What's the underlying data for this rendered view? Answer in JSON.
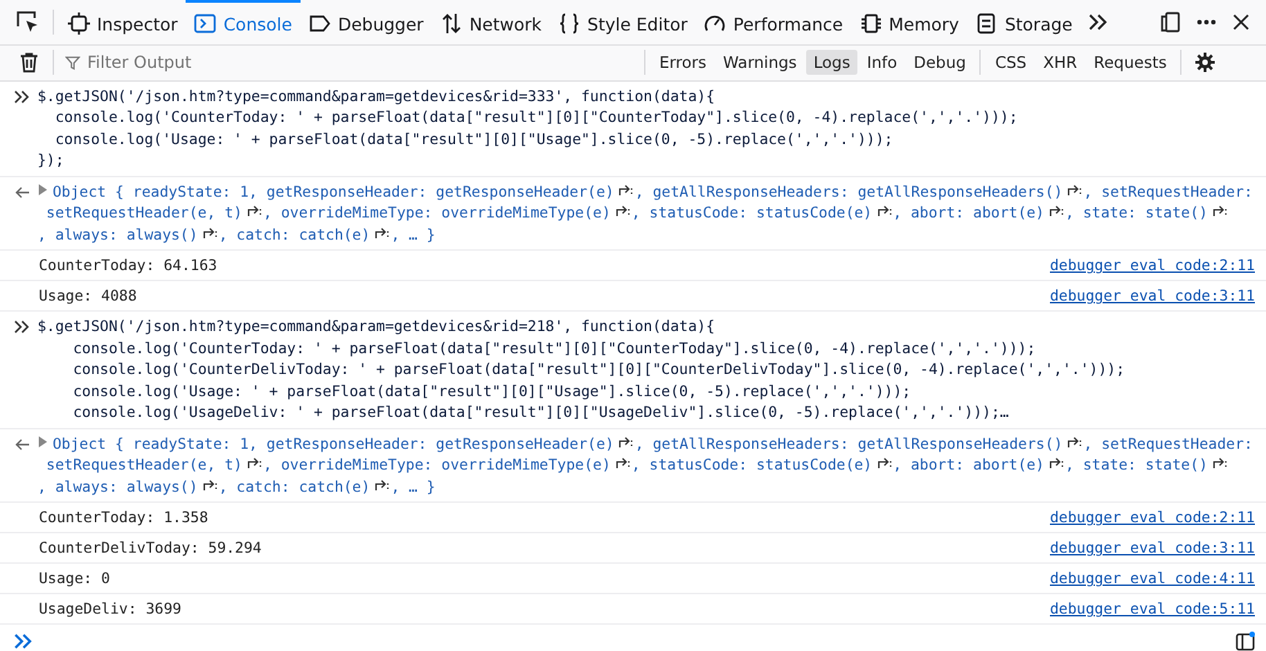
{
  "toolbar": {
    "tabs": [
      {
        "label": "Inspector",
        "selected": false
      },
      {
        "label": "Console",
        "selected": true
      },
      {
        "label": "Debugger",
        "selected": false
      },
      {
        "label": "Network",
        "selected": false
      },
      {
        "label": "Style Editor",
        "selected": false
      },
      {
        "label": "Performance",
        "selected": false
      },
      {
        "label": "Memory",
        "selected": false
      },
      {
        "label": "Storage",
        "selected": false
      }
    ]
  },
  "filter_bar": {
    "placeholder": "Filter Output",
    "filters": [
      {
        "label": "Errors",
        "selected": false
      },
      {
        "label": "Warnings",
        "selected": false
      },
      {
        "label": "Logs",
        "selected": true
      },
      {
        "label": "Info",
        "selected": false
      },
      {
        "label": "Debug",
        "selected": false
      },
      {
        "label": "CSS",
        "selected": false
      },
      {
        "label": "XHR",
        "selected": false
      },
      {
        "label": "Requests",
        "selected": false
      }
    ]
  },
  "messages": [
    {
      "kind": "input",
      "lines": [
        "$.getJSON('/json.htm?type=command&param=getdevices&rid=333', function(data){",
        "  console.log('CounterToday: ' + parseFloat(data[\"result\"][0][\"CounterToday\"].slice(0, -4).replace(',','.')));",
        "  console.log('Usage: ' + parseFloat(data[\"result\"][0][\"Usage\"].slice(0, -5).replace(',','.')));",
        "});"
      ]
    },
    {
      "kind": "result",
      "parts": [
        {
          "text": "Object { readyState: 1, getResponseHeader:",
          "kind": "key"
        },
        {
          "text": "getResponseHeader(e)",
          "kind": "function"
        },
        {
          "text": ", getAllResponseHeaders:",
          "kind": "key"
        },
        {
          "text": "getAllResponseHeaders()",
          "kind": "function"
        },
        {
          "text": ", setRequestHeader:",
          "kind": "key"
        },
        {
          "text": "setRequestHeader(e, t)",
          "kind": "function"
        },
        {
          "text": ", overrideMimeType:",
          "kind": "key"
        },
        {
          "text": "overrideMimeType(e)",
          "kind": "function"
        },
        {
          "text": ", statusCode:",
          "kind": "key"
        },
        {
          "text": "statusCode(e)",
          "kind": "function"
        },
        {
          "text": ", abort:",
          "kind": "key"
        },
        {
          "text": "abort(e)",
          "kind": "function"
        },
        {
          "text": ", state:",
          "kind": "key"
        },
        {
          "text": "state()",
          "kind": "function"
        },
        {
          "text": ", always:",
          "kind": "key"
        },
        {
          "text": "always()",
          "kind": "function"
        },
        {
          "text": ", catch:",
          "kind": "key"
        },
        {
          "text": "catch(e)",
          "kind": "function"
        },
        {
          "text": ", … }",
          "kind": "key"
        }
      ]
    },
    {
      "kind": "log",
      "text": "CounterToday: 64.163",
      "location": "debugger eval code:2:11"
    },
    {
      "kind": "log",
      "text": "Usage: 4088",
      "location": "debugger eval code:3:11"
    },
    {
      "kind": "input",
      "lines": [
        "$.getJSON('/json.htm?type=command&param=getdevices&rid=218', function(data){",
        "    console.log('CounterToday: ' + parseFloat(data[\"result\"][0][\"CounterToday\"].slice(0, -4).replace(',','.')));",
        "    console.log('CounterDelivToday: ' + parseFloat(data[\"result\"][0][\"CounterDelivToday\"].slice(0, -4).replace(',','.')));",
        "    console.log('Usage: ' + parseFloat(data[\"result\"][0][\"Usage\"].slice(0, -5).replace(',','.')));",
        "    console.log('UsageDeliv: ' + parseFloat(data[\"result\"][0][\"UsageDeliv\"].slice(0, -5).replace(',','.')));…"
      ]
    },
    {
      "kind": "result",
      "parts": [
        {
          "text": "Object { readyState: 1, getResponseHeader:",
          "kind": "key"
        },
        {
          "text": "getResponseHeader(e)",
          "kind": "function"
        },
        {
          "text": ", getAllResponseHeaders:",
          "kind": "key"
        },
        {
          "text": "getAllResponseHeaders()",
          "kind": "function"
        },
        {
          "text": ", setRequestHeader:",
          "kind": "key"
        },
        {
          "text": "setRequestHeader(e, t)",
          "kind": "function"
        },
        {
          "text": ", overrideMimeType:",
          "kind": "key"
        },
        {
          "text": "overrideMimeType(e)",
          "kind": "function"
        },
        {
          "text": ", statusCode:",
          "kind": "key"
        },
        {
          "text": "statusCode(e)",
          "kind": "function"
        },
        {
          "text": ", abort:",
          "kind": "key"
        },
        {
          "text": "abort(e)",
          "kind": "function"
        },
        {
          "text": ", state:",
          "kind": "key"
        },
        {
          "text": "state()",
          "kind": "function"
        },
        {
          "text": ", always:",
          "kind": "key"
        },
        {
          "text": "always()",
          "kind": "function"
        },
        {
          "text": ", catch:",
          "kind": "key"
        },
        {
          "text": "catch(e)",
          "kind": "function"
        },
        {
          "text": ", … }",
          "kind": "key"
        }
      ]
    },
    {
      "kind": "log",
      "text": "CounterToday: 1.358",
      "location": "debugger eval code:2:11"
    },
    {
      "kind": "log",
      "text": "CounterDelivToday: 59.294",
      "location": "debugger eval code:3:11"
    },
    {
      "kind": "log",
      "text": "Usage: 0",
      "location": "debugger eval code:4:11"
    },
    {
      "kind": "log",
      "text": "UsageDeliv: 3699",
      "location": "debugger eval code:5:11"
    }
  ]
}
